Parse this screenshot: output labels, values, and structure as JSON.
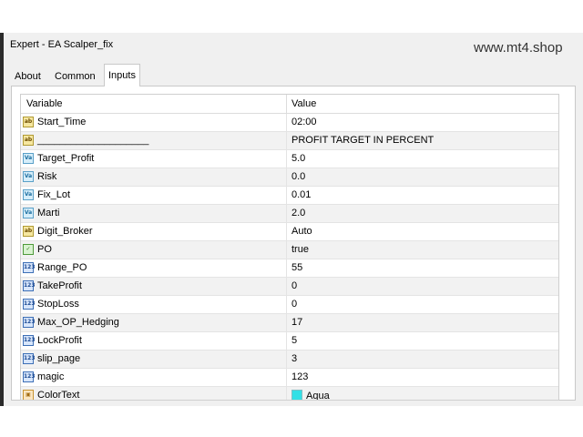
{
  "window": {
    "title": "Expert - EA Scalper_fix"
  },
  "watermark": "www.mt4.shop",
  "tabs": [
    {
      "label": "About",
      "active": false
    },
    {
      "label": "Common",
      "active": false
    },
    {
      "label": "Inputs",
      "active": true
    }
  ],
  "table": {
    "headers": {
      "variable": "Variable",
      "value": "Value"
    },
    "rows": [
      {
        "icon": "ab-string-icon",
        "name": "Start_Time",
        "value": "02:00"
      },
      {
        "icon": "ab-string-icon",
        "name": "____________________",
        "value": "PROFIT TARGET IN PERCENT"
      },
      {
        "icon": "va-double-icon",
        "name": "Target_Profit",
        "value": "5.0"
      },
      {
        "icon": "va-double-icon",
        "name": "Risk",
        "value": "0.0"
      },
      {
        "icon": "va-double-icon",
        "name": "Fix_Lot",
        "value": "0.01"
      },
      {
        "icon": "va-double-icon",
        "name": "Marti",
        "value": "2.0"
      },
      {
        "icon": "ab-string-icon",
        "name": "Digit_Broker",
        "value": "Auto"
      },
      {
        "icon": "bool-icon",
        "name": "PO",
        "value": "true"
      },
      {
        "icon": "int-icon",
        "name": "Range_PO",
        "value": "55"
      },
      {
        "icon": "int-icon",
        "name": "TakeProfit",
        "value": "0"
      },
      {
        "icon": "int-icon",
        "name": "StopLoss",
        "value": "0"
      },
      {
        "icon": "int-icon",
        "name": "Max_OP_Hedging",
        "value": "17"
      },
      {
        "icon": "int-icon",
        "name": "LockProfit",
        "value": "5"
      },
      {
        "icon": "int-icon",
        "name": "slip_page",
        "value": "3"
      },
      {
        "icon": "int-icon",
        "name": "magic",
        "value": "123"
      },
      {
        "icon": "color-icon",
        "name": "ColorText",
        "value": "Aqua",
        "swatch": "#33e0e6"
      }
    ]
  }
}
